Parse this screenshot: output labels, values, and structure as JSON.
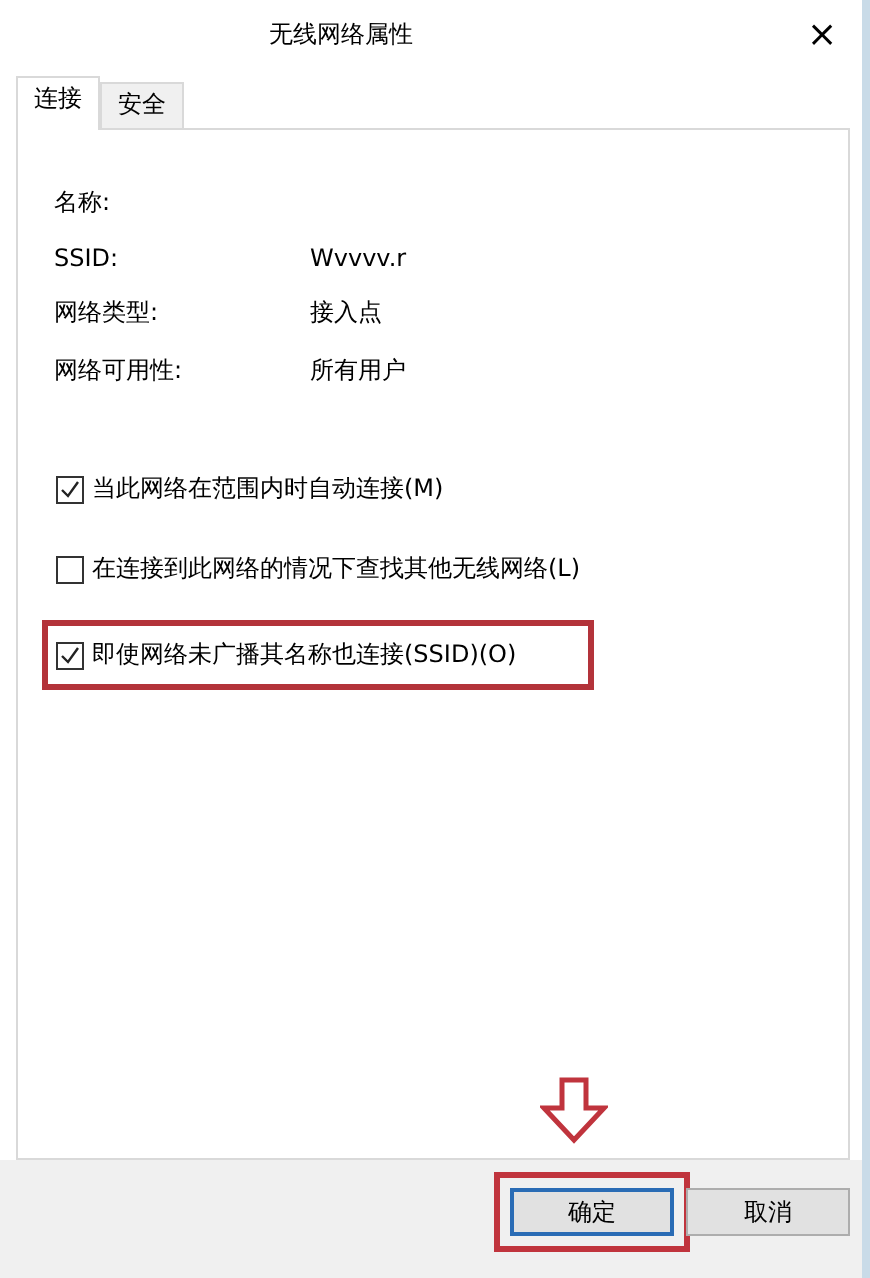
{
  "window": {
    "title": "无线网络属性",
    "close": "×"
  },
  "tabs": [
    {
      "label": "连接",
      "selected": true
    },
    {
      "label": "安全",
      "selected": false
    }
  ],
  "properties": [
    {
      "label": "名称:"
    },
    {
      "label": "SSID:",
      "value": "Wvvvv.r"
    },
    {
      "label": "网络类型:",
      "value": "接入点"
    },
    {
      "label": "网络可用性:",
      "value": "所有用户"
    }
  ],
  "options": [
    {
      "label": "当此网络在范围内时自动连接(M)",
      "checked": true,
      "highlighted": false
    },
    {
      "label": "在连接到此网络的情况下查找其他无线网络(L)",
      "checked": false,
      "highlighted": false
    },
    {
      "label": "即使网络未广播其名称也连接(SSID)(O)",
      "checked": true,
      "highlighted": true
    }
  ],
  "buttons": [
    {
      "label": "确定",
      "highlighted": true
    },
    {
      "label": "取消",
      "highlighted": false
    }
  ]
}
